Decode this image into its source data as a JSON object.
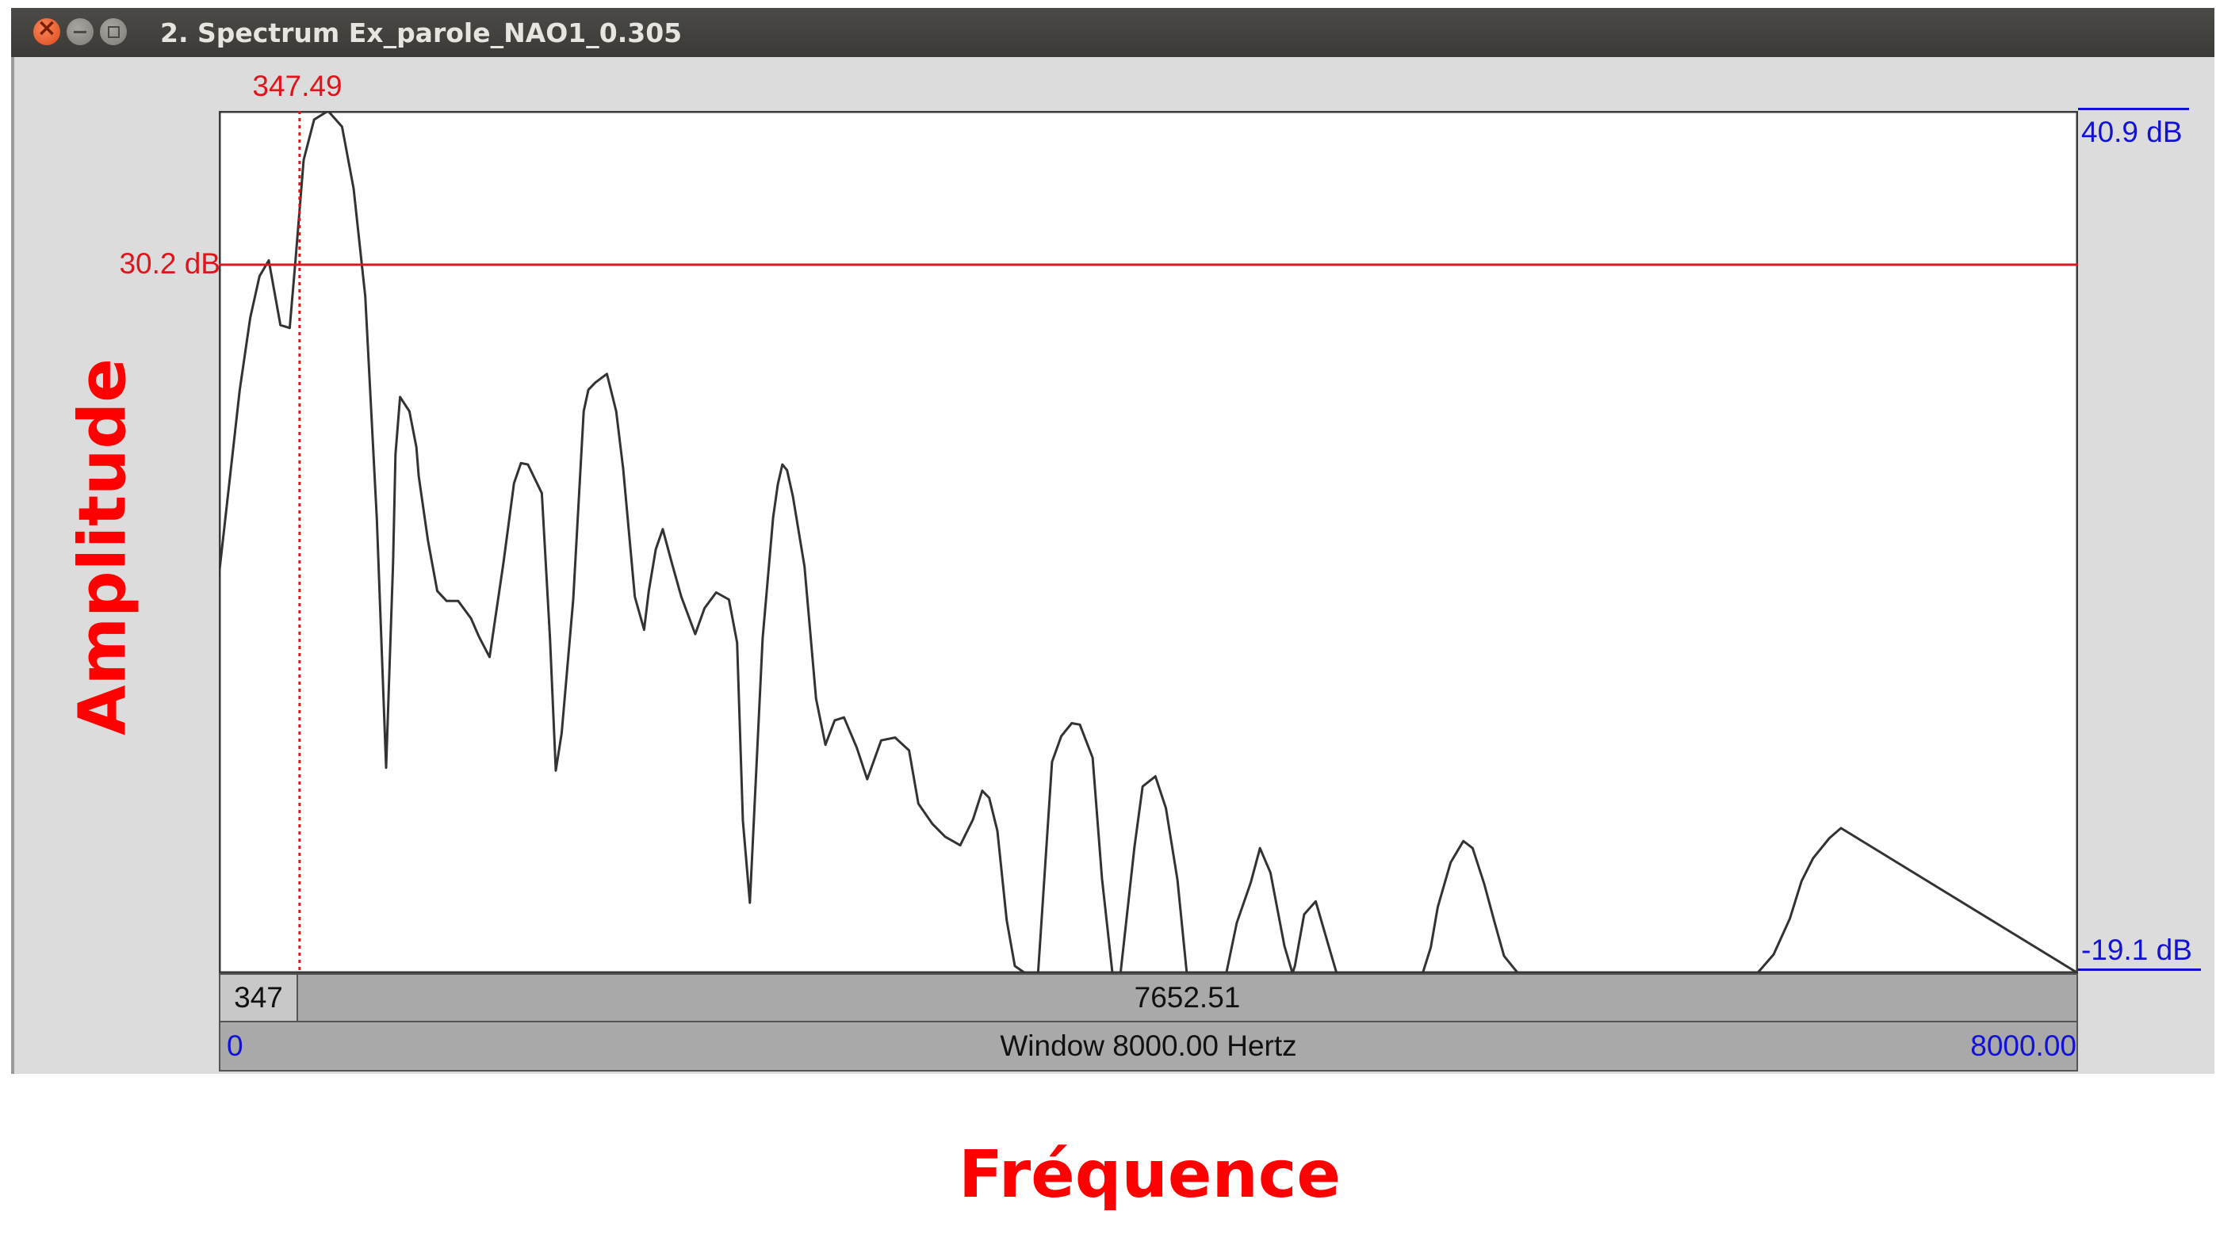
{
  "window": {
    "title": "2. Spectrum Ex_parole_NAO1_0.305",
    "controls": [
      "close-icon",
      "minimize-icon",
      "maximize-icon"
    ]
  },
  "colors": {
    "cursor": "#e0151b",
    "scale": "#1212d6",
    "curve": "#333333",
    "annotation": "#ff0000"
  },
  "cursor": {
    "frequency_label": "347.49",
    "level_label": "30.2 dB",
    "frequency_hz": 347.49,
    "level_db": 30.2
  },
  "scale": {
    "top_label": "40.9 dB",
    "bottom_label": "-19.1 dB"
  },
  "selection_bar": {
    "left": "347",
    "right": "7652.51"
  },
  "window_bar": {
    "start": "0",
    "center": "Window 8000.00 Hertz",
    "end": "8000.00"
  },
  "annotations": {
    "y_axis": "Amplitude",
    "x_axis": "Fréquence"
  },
  "chart_data": {
    "type": "line",
    "xlim": [
      0,
      8000
    ],
    "ylim": [
      -19.1,
      40.9
    ],
    "cursor": {
      "x": 347.49,
      "y": 30.2
    },
    "series": [
      {
        "x": [
          0,
          45,
          90,
          135,
          175,
          215,
          265,
          305,
          330,
          365,
          410,
          470,
          530,
          580,
          630,
          680,
          720,
          750,
          760,
          780,
          820,
          850,
          860,
          900,
          940,
          980,
          1030,
          1085,
          1120,
          1165,
          1225,
          1270,
          1300,
          1330,
          1390,
          1425,
          1450,
          1475,
          1525,
          1570,
          1590,
          1620,
          1670,
          1710,
          1740,
          1790,
          1830,
          1850,
          1880,
          1910,
          1950,
          1990,
          2050,
          2090,
          2140,
          2195,
          2230,
          2255,
          2285,
          2340,
          2385,
          2405,
          2425,
          2445,
          2470,
          2520,
          2570,
          2610,
          2650,
          2690,
          2745,
          2790,
          2850,
          2910,
          2970,
          3010,
          3070,
          3125,
          3190,
          3245,
          3285,
          3315,
          3350,
          3390,
          3425,
          3470,
          3500,
          3525,
          3585,
          3625,
          3670,
          3705,
          3760,
          3800,
          3845,
          3880,
          3940,
          3975,
          4030,
          4075,
          4125,
          4165,
          4210,
          4285,
          4320,
          4335,
          4380,
          4440,
          4480,
          4525,
          4585,
          4620,
          4630,
          4670,
          4720,
          4770,
          4810,
          4870,
          4920,
          4955,
          5010,
          5055,
          5120,
          5180,
          5215,
          5245,
          5300,
          5355,
          5395,
          5445,
          5490,
          5530,
          5590,
          5660,
          5710,
          5775,
          5830,
          6040,
          6360,
          6620,
          6690,
          6760,
          6810,
          6860,
          6930,
          6980,
          8000
        ],
        "y": [
          8.5,
          15.0,
          21.5,
          26.5,
          29.4,
          30.5,
          26.0,
          25.8,
          30.5,
          37.5,
          40.3,
          40.9,
          39.8,
          35.5,
          28.0,
          12.5,
          -4.8,
          9.5,
          17.0,
          21.0,
          20.0,
          17.5,
          15.5,
          11.0,
          7.5,
          6.8,
          6.8,
          5.6,
          4.3,
          2.9,
          9.5,
          15.0,
          16.4,
          16.3,
          14.3,
          4.2,
          -5.0,
          -2.4,
          6.9,
          20.0,
          21.5,
          22.0,
          22.6,
          20.0,
          16.0,
          7.1,
          4.8,
          7.5,
          10.4,
          11.8,
          9.4,
          7.1,
          4.5,
          6.3,
          7.4,
          6.9,
          3.9,
          -8.5,
          -14.2,
          4.2,
          12.6,
          14.9,
          16.3,
          15.9,
          14.1,
          9.2,
          0.0,
          -3.2,
          -1.5,
          -1.3,
          -3.4,
          -5.6,
          -2.9,
          -2.7,
          -3.6,
          -7.3,
          -8.7,
          -9.6,
          -10.2,
          -8.4,
          -6.4,
          -6.9,
          -9.2,
          -15.4,
          -18.6,
          -19.1,
          -19.1,
          -19.1,
          -4.4,
          -2.6,
          -1.7,
          -1.8,
          -4.1,
          -12.5,
          -20.5,
          -19.4,
          -10.3,
          -6.1,
          -5.4,
          -7.6,
          -12.6,
          -19.1,
          -19.1,
          -19.1,
          -19.1,
          -19.1,
          -15.6,
          -12.8,
          -10.4,
          -12.1,
          -17.2,
          -19.1,
          -18.6,
          -15.0,
          -14.1,
          -16.9,
          -19.1,
          -19.1,
          -19.1,
          -19.1,
          -19.1,
          -19.1,
          -19.1,
          -19.1,
          -17.3,
          -14.5,
          -11.4,
          -9.9,
          -10.4,
          -12.9,
          -15.6,
          -17.9,
          -19.1,
          -19.1,
          -19.1,
          -19.1,
          -19.1,
          -19.1,
          -19.1,
          -19.1,
          -17.8,
          -15.3,
          -12.7,
          -11.1,
          -9.7,
          -9.0,
          -19.1
        ]
      }
    ]
  }
}
